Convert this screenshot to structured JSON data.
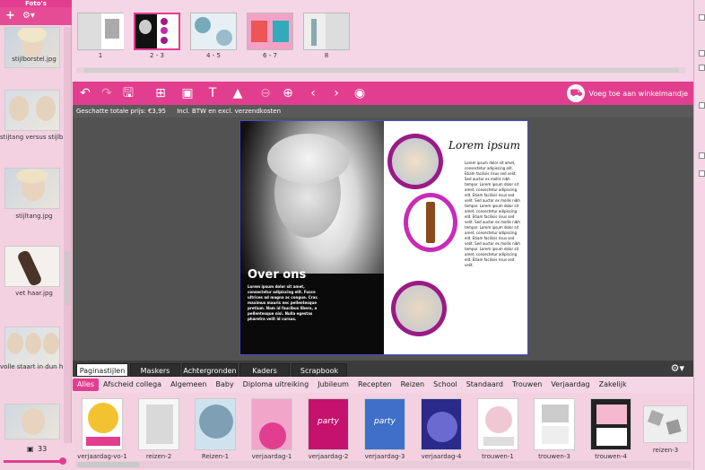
{
  "left_panel": {
    "title": "Foto's",
    "add_label": "+",
    "settings_label": "⚙▾",
    "photos": [
      {
        "label": "stijlborstel.jpg"
      },
      {
        "label": "stijtang versus stijlb..."
      },
      {
        "label": "stijltang.jpg"
      },
      {
        "label": "vet haar.jpg"
      },
      {
        "label": "volle staart in dun h..."
      }
    ],
    "photo_count": "33"
  },
  "pages": [
    {
      "label": "1"
    },
    {
      "label": "2 - 3"
    },
    {
      "label": "4 - 5"
    },
    {
      "label": "6 - 7"
    },
    {
      "label": "8"
    }
  ],
  "toolbar": {
    "cart_label": "Voeg toe aan winkelmandje",
    "icons": [
      "undo-icon",
      "redo-icon",
      "save-icon",
      "add-page-icon",
      "add-photo-icon",
      "add-text-icon",
      "background-icon",
      "zoom-out-icon",
      "zoom-in-icon",
      "previous-icon",
      "next-icon",
      "preview-icon"
    ]
  },
  "price_bar": {
    "price": "Geschatte totale prijs: €3,95",
    "tax_note": "Incl. BTW en excl. verzendkosten"
  },
  "spread": {
    "left_heading": "Over ons",
    "left_body": "Lorem ipsum dolor sit amet, consectetur adipiscing elit. Fusce ultrices ad magna ac congue. Cras maximus mauris nec pellentesque pretium. Nam id faucibus libero, a pellentesque nisi. Nulla egestas pharetra velit id cursus.",
    "right_heading": "Lorem ipsum",
    "right_body": "Lorem ipsum dolor sit amet, consectetur adipiscing elit. Etiam facilisis risus sed velit. Sed auctor ex mollis nibh tempor. Lorem ipsum dolor sit amet, consectetur adipiscing elit. Etiam facilisis risus sed velit. Sed auctor ex mollis nibh tempor. Lorem ipsum dolor sit amet, consectetur adipiscing elit. Etiam facilisis risus sed velit. Sed auctor ex mollis nibh tempor. Lorem ipsum dolor sit amet, consectetur adipiscing elit. Etiam facilisis risus sed velit. Sed auctor ex mollis nibh tempor. Lorem ipsum dolor sit amet, consectetur adipiscing elit. Etiam facilisis risus sed velit."
  },
  "tabs": [
    {
      "label": "Paginastijlen"
    },
    {
      "label": "Maskers"
    },
    {
      "label": "Achtergronden"
    },
    {
      "label": "Kaders"
    },
    {
      "label": "Scrapbook"
    }
  ],
  "categories": [
    "Alles",
    "Afscheid collega",
    "Algemeen",
    "Baby",
    "Diploma uitreiking",
    "Jubileum",
    "Recepten",
    "Reizen",
    "School",
    "Standaard",
    "Trouwen",
    "Verjaardag",
    "Zakelijk"
  ],
  "styles": [
    {
      "label": "verjaardag-vo-1"
    },
    {
      "label": "reizen-2"
    },
    {
      "label": "Reizen-1"
    },
    {
      "label": "verjaardag-1"
    },
    {
      "label": "verjaardag-2"
    },
    {
      "label": "verjaardag-3"
    },
    {
      "label": "verjaardag-4"
    },
    {
      "label": "trouwen-1"
    },
    {
      "label": "trouwen-3"
    },
    {
      "label": "trouwen-4"
    },
    {
      "label": "reizen-3"
    }
  ],
  "colors": {
    "accent": "#e23e8f",
    "panel": "#f3d1e1"
  }
}
